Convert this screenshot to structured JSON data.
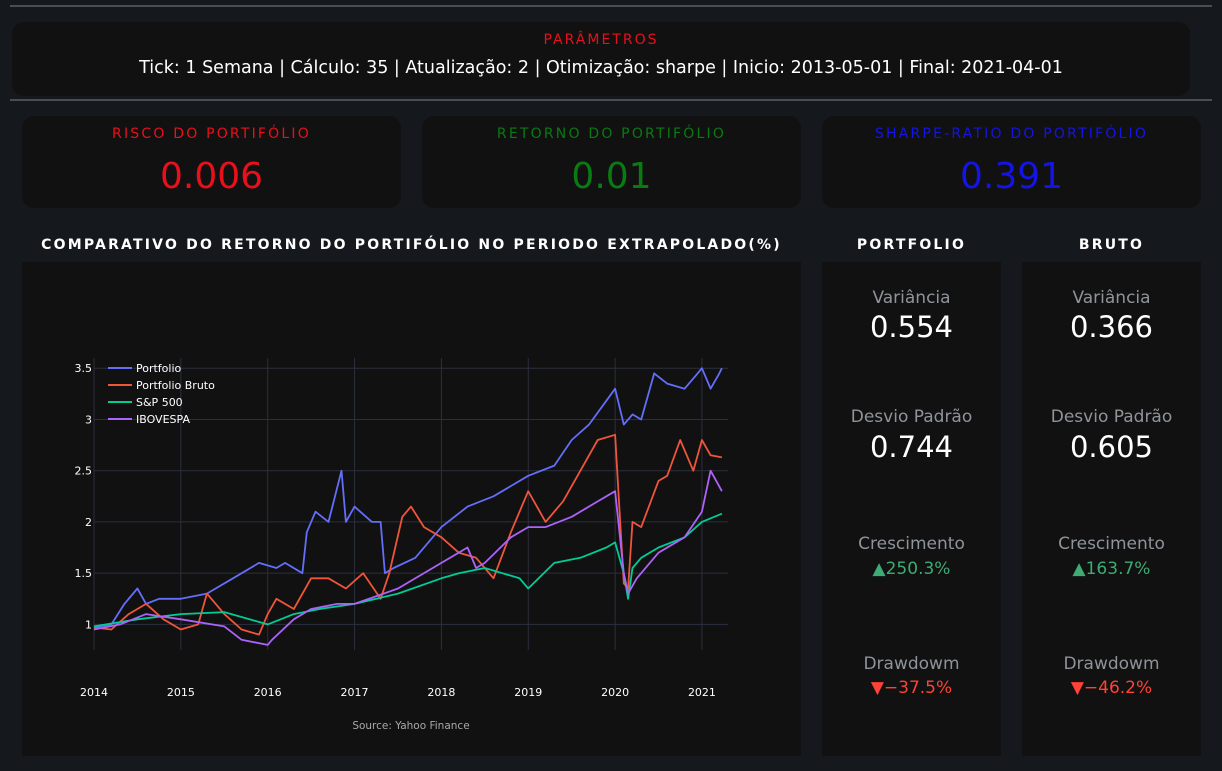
{
  "params": {
    "title": "PARÂMETROS",
    "line": "Tick: 1 Semana | Cálculo: 35 | Atualização: 2 | Otimização: sharpe | Inicio: 2013-05-01 | Final: 2021-04-01"
  },
  "kpis": {
    "risk": {
      "label": "RISCO DO PORTIFÓLIO",
      "value": "0.006",
      "color": "#e8101a"
    },
    "return": {
      "label": "RETORNO DO PORTIFÓLIO",
      "value": "0.01",
      "color": "#0a7a12"
    },
    "sharpe": {
      "label": "SHARPE-RATIO DO PORTIFÓLIO",
      "value": "0.391",
      "color": "#1414e6"
    }
  },
  "chart": {
    "section_title": "COMPARATIVO DO RETORNO DO PORTIFÓLIO NO PERIODO EXTRAPOLADO(%)",
    "source": "Source: Yahoo Finance"
  },
  "portfolio": {
    "title": "PORTFOLIO",
    "variance_label": "Variância",
    "variance": "0.554",
    "std_label": "Desvio Padrão",
    "std": "0.744",
    "growth_label": "Crescimento",
    "growth": "▲250.3%",
    "drawdown_label": "Drawdowm",
    "drawdown": "▼−37.5%"
  },
  "bruto": {
    "title": "BRUTO",
    "variance_label": "Variância",
    "variance": "0.366",
    "std_label": "Desvio Padrão",
    "std": "0.605",
    "growth_label": "Crescimento",
    "growth": "▲163.7%",
    "drawdown_label": "Drawdowm",
    "drawdown": "▼−46.2%"
  },
  "colors": {
    "up": "#3dab73",
    "down": "#ff4136"
  },
  "chart_data": {
    "type": "line",
    "title": "",
    "xlabel": "",
    "ylabel": "",
    "ylim": [
      0.75,
      3.6
    ],
    "xlim": [
      2014,
      2021.3
    ],
    "x_ticks": [
      "2014",
      "2015",
      "2016",
      "2017",
      "2018",
      "2019",
      "2020",
      "2021"
    ],
    "y_ticks": [
      "1",
      "1.5",
      "2",
      "2.5",
      "3",
      "3.5"
    ],
    "legend_position": "top-left",
    "series": [
      {
        "name": "Portfolio",
        "color": "#636efa",
        "x": [
          2014.0,
          2014.2,
          2014.35,
          2014.5,
          2014.6,
          2014.75,
          2015.0,
          2015.3,
          2015.6,
          2015.9,
          2016.1,
          2016.2,
          2016.4,
          2016.45,
          2016.55,
          2016.7,
          2016.85,
          2016.9,
          2017.0,
          2017.2,
          2017.3,
          2017.35,
          2017.45,
          2017.7,
          2018.0,
          2018.3,
          2018.6,
          2019.0,
          2019.3,
          2019.5,
          2019.7,
          2020.0,
          2020.1,
          2020.2,
          2020.3,
          2020.45,
          2020.6,
          2020.8,
          2020.95,
          2021.0,
          2021.1,
          2021.2,
          2021.23
        ],
        "y": [
          0.97,
          1.0,
          1.2,
          1.35,
          1.2,
          1.25,
          1.25,
          1.3,
          1.45,
          1.6,
          1.55,
          1.6,
          1.5,
          1.9,
          2.1,
          2.0,
          2.5,
          2.0,
          2.15,
          2.0,
          2.0,
          1.5,
          1.55,
          1.65,
          1.95,
          2.15,
          2.25,
          2.45,
          2.55,
          2.8,
          2.95,
          3.3,
          2.95,
          3.05,
          3.0,
          3.45,
          3.35,
          3.3,
          3.45,
          3.5,
          3.3,
          3.45,
          3.5
        ]
      },
      {
        "name": "Portfolio Bruto",
        "color": "#ef553b",
        "x": [
          2014.0,
          2014.2,
          2014.4,
          2014.6,
          2014.8,
          2015.0,
          2015.2,
          2015.3,
          2015.5,
          2015.7,
          2015.9,
          2016.0,
          2016.1,
          2016.3,
          2016.5,
          2016.7,
          2016.9,
          2017.1,
          2017.3,
          2017.4,
          2017.55,
          2017.65,
          2017.8,
          2018.0,
          2018.2,
          2018.4,
          2018.6,
          2018.8,
          2019.0,
          2019.2,
          2019.4,
          2019.6,
          2019.8,
          2020.0,
          2020.1,
          2020.15,
          2020.2,
          2020.3,
          2020.5,
          2020.6,
          2020.75,
          2020.9,
          2021.0,
          2021.1,
          2021.23
        ],
        "y": [
          0.97,
          0.95,
          1.1,
          1.2,
          1.05,
          0.95,
          1.0,
          1.3,
          1.1,
          0.95,
          0.9,
          1.1,
          1.25,
          1.15,
          1.45,
          1.45,
          1.35,
          1.5,
          1.25,
          1.5,
          2.05,
          2.15,
          1.95,
          1.85,
          1.7,
          1.65,
          1.45,
          1.9,
          2.3,
          2.0,
          2.2,
          2.5,
          2.8,
          2.85,
          1.4,
          1.35,
          2.0,
          1.95,
          2.4,
          2.45,
          2.8,
          2.5,
          2.8,
          2.65,
          2.63
        ]
      },
      {
        "name": "S&P 500",
        "color": "#00cc96",
        "x": [
          2014.0,
          2014.5,
          2015.0,
          2015.5,
          2016.0,
          2016.3,
          2016.6,
          2017.0,
          2017.5,
          2018.0,
          2018.2,
          2018.5,
          2018.9,
          2019.0,
          2019.3,
          2019.6,
          2019.9,
          2020.0,
          2020.1,
          2020.15,
          2020.2,
          2020.3,
          2020.5,
          2020.8,
          2021.0,
          2021.23
        ],
        "y": [
          0.98,
          1.05,
          1.1,
          1.12,
          1.0,
          1.1,
          1.15,
          1.2,
          1.3,
          1.45,
          1.5,
          1.55,
          1.45,
          1.35,
          1.6,
          1.65,
          1.75,
          1.8,
          1.5,
          1.25,
          1.55,
          1.65,
          1.75,
          1.85,
          2.0,
          2.08
        ]
      },
      {
        "name": "IBOVESPA",
        "color": "#ab63fa",
        "x": [
          2014.0,
          2014.3,
          2014.6,
          2015.0,
          2015.5,
          2015.7,
          2016.0,
          2016.05,
          2016.3,
          2016.5,
          2016.8,
          2017.0,
          2017.5,
          2018.0,
          2018.3,
          2018.4,
          2018.5,
          2018.8,
          2019.0,
          2019.2,
          2019.5,
          2019.8,
          2020.0,
          2020.1,
          2020.15,
          2020.25,
          2020.5,
          2020.8,
          2021.0,
          2021.1,
          2021.23
        ],
        "y": [
          0.95,
          1.0,
          1.1,
          1.05,
          0.98,
          0.85,
          0.8,
          0.85,
          1.05,
          1.15,
          1.2,
          1.2,
          1.35,
          1.6,
          1.75,
          1.55,
          1.6,
          1.85,
          1.95,
          1.95,
          2.05,
          2.2,
          2.3,
          1.5,
          1.3,
          1.45,
          1.7,
          1.85,
          2.1,
          2.5,
          2.3
        ]
      }
    ]
  }
}
